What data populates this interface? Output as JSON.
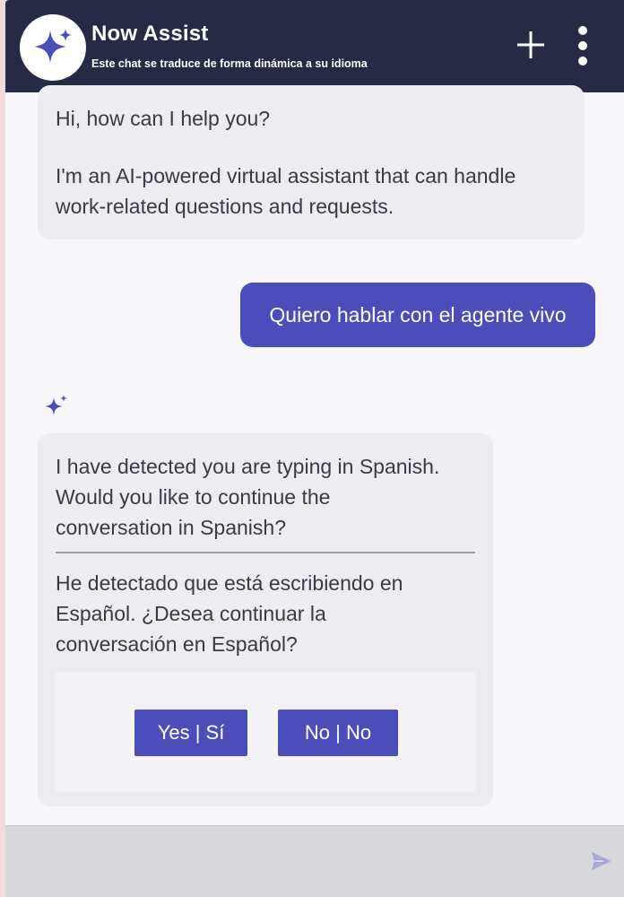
{
  "header": {
    "title": "Now Assist",
    "subtitle": "Este chat se traduce de forma dinámica a su idioma",
    "icons": {
      "avatar": "sparkle-icon",
      "new_chat": "plus-icon",
      "menu": "more-vertical-icon"
    }
  },
  "messages": {
    "bot_greeting_line1": "Hi, how can I help you?",
    "bot_greeting_line2": "I'm an AI-powered virtual assistant that can handle",
    "bot_greeting_line3": "work-related questions and requests.",
    "user_message": "Quiero hablar con el agente vivo",
    "bot_detect_en_line1": "I have detected you are typing in Spanish.",
    "bot_detect_en_line2": "Would you like to continue the",
    "bot_detect_en_line3": "conversation in Spanish?",
    "bot_detect_es_line1": "He detectado que está escribiendo en",
    "bot_detect_es_line2": "Español. ¿Desea continuar la",
    "bot_detect_es_line3": "conversación en Español?"
  },
  "choices": {
    "yes_label": "Yes | Sí",
    "no_label": "No | No"
  },
  "input": {
    "value": "",
    "placeholder": "",
    "send_icon": "send-icon"
  },
  "colors": {
    "header_bg": "#262a44",
    "accent": "#4b4dbb",
    "bot_bubble": "#ececf1",
    "page_bg": "#f7f7f9"
  }
}
